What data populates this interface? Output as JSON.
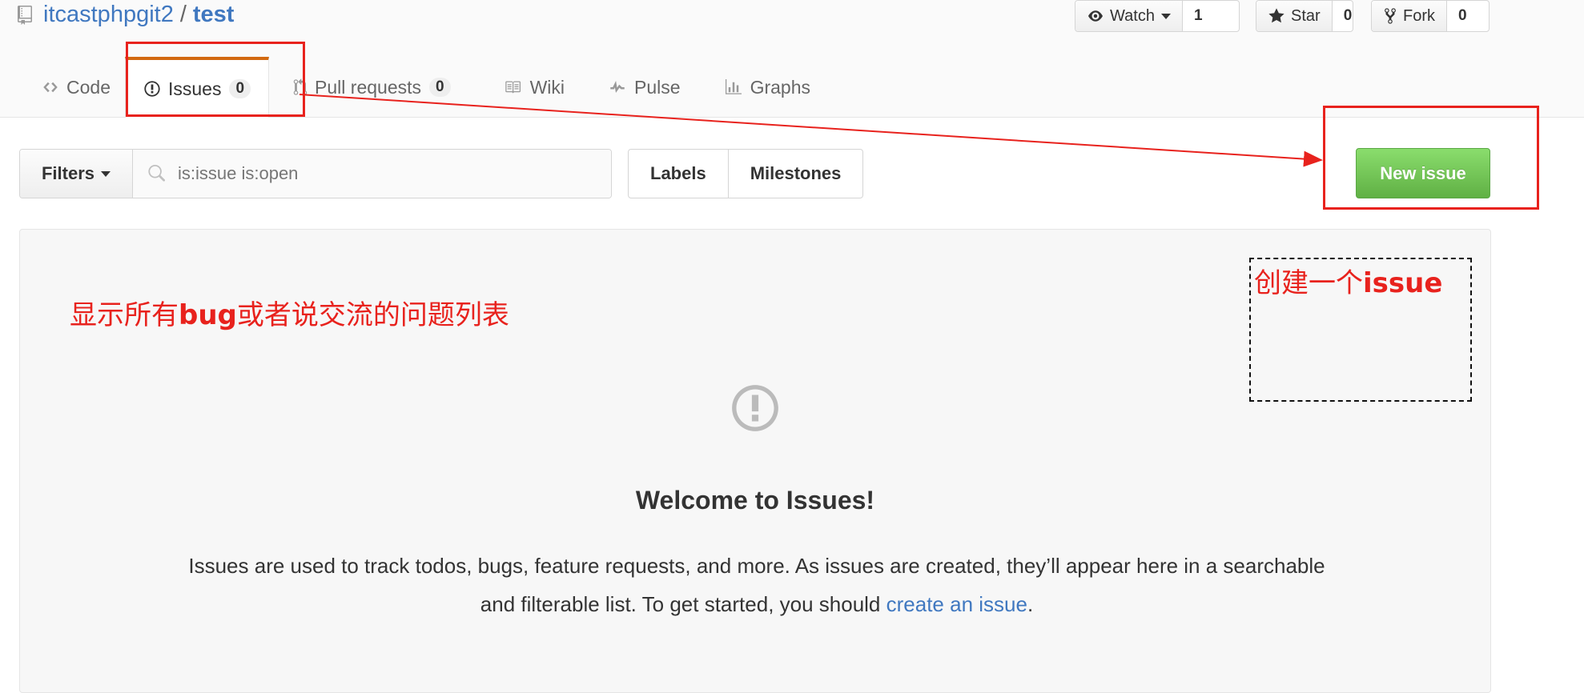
{
  "repo": {
    "owner": "itcastphpgit2",
    "separator": "/",
    "name": "test"
  },
  "header_actions": {
    "watch": {
      "label": "Watch",
      "count": "1"
    },
    "star": {
      "label": "Star",
      "count": "0"
    },
    "fork": {
      "label": "Fork",
      "count": "0"
    }
  },
  "tabs": [
    {
      "label": "Code",
      "icon": "code-icon"
    },
    {
      "label": "Issues",
      "count": "0",
      "icon": "issue-opened-icon",
      "selected": true
    },
    {
      "label": "Pull requests",
      "count": "0",
      "icon": "git-pull-request-icon"
    },
    {
      "label": "Wiki",
      "icon": "book-icon"
    },
    {
      "label": "Pulse",
      "icon": "pulse-icon"
    },
    {
      "label": "Graphs",
      "icon": "graph-icon"
    }
  ],
  "filter_bar": {
    "filters_label": "Filters",
    "search_value": "is:issue is:open",
    "labels_label": "Labels",
    "milestones_label": "Milestones",
    "new_issue_label": "New issue"
  },
  "blankslate": {
    "title": "Welcome to Issues!",
    "text_line1": "Issues are used to track todos, bugs, feature requests, and more. As issues are created, they’ll appear here in a searchable",
    "text_line2_prefix": "and filterable list. To get started, you should ",
    "text_link": "create an issue",
    "text_line2_suffix": "."
  },
  "annotations": {
    "left_note_prefix": "显示所有",
    "left_note_bold": "bug",
    "left_note_suffix": "或者说交流的问题列表",
    "right_note_prefix": "创建一个",
    "right_note_bold": "issue",
    "color": "#e8221d"
  },
  "colors": {
    "link": "#4078c0",
    "tab_accent": "#d26911",
    "new_issue_green": "#60b044",
    "annotation_red": "#e8221d"
  }
}
